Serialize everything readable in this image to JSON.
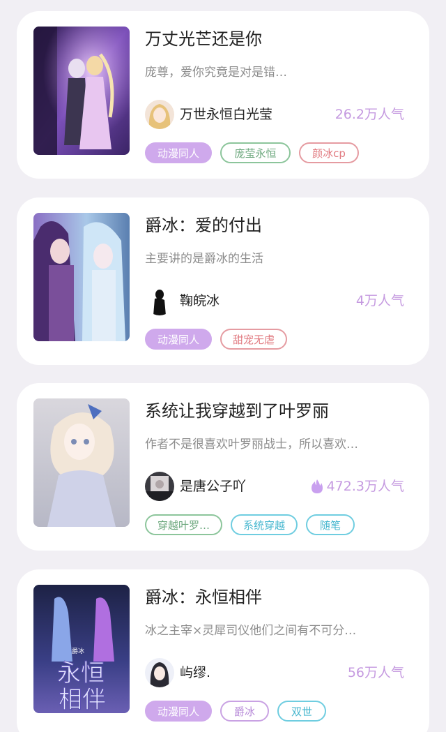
{
  "stories": [
    {
      "title": "万丈光芒还是你",
      "description": "庞尊，爱你究竟是对是错…",
      "author": "万世永恒白光莹",
      "popularity": "26.2万人气",
      "hot": false,
      "cover_icon": "cover-art-purple-couple",
      "tags": [
        {
          "label": "动漫同人",
          "style": "fill-purple"
        },
        {
          "label": "庞莹永恒",
          "style": "out-green"
        },
        {
          "label": "颜冰cp",
          "style": "out-red"
        }
      ]
    },
    {
      "title": "爵冰：爱的付出",
      "description": "主要讲的是爵冰的生活",
      "author": "鞠皖冰",
      "popularity": "4万人气",
      "hot": false,
      "cover_icon": "cover-art-blue-pair",
      "tags": [
        {
          "label": "动漫同人",
          "style": "fill-purple"
        },
        {
          "label": "甜宠无虐",
          "style": "out-red"
        }
      ]
    },
    {
      "title": "系统让我穿越到了叶罗丽",
      "description": "作者不是很喜欢叶罗丽战士，所以喜欢…",
      "author": "是唐公子吖",
      "popularity": "472.3万人气",
      "hot": true,
      "cover_icon": "cover-art-doll-girl",
      "tags": [
        {
          "label": "穿越叶罗…",
          "style": "out-green"
        },
        {
          "label": "系统穿越",
          "style": "out-cyan"
        },
        {
          "label": "随笔",
          "style": "out-cyan"
        }
      ]
    },
    {
      "title": "爵冰：永恒相伴",
      "description": "冰之主宰×灵犀司仪他们之间有不可分…",
      "author": "屿缪.",
      "popularity": "56万人气",
      "hot": false,
      "cover_icon": "cover-art-eternal-companion",
      "cover_text": {
        "small": "爵冰",
        "large": "永恒相伴"
      },
      "tags": [
        {
          "label": "动漫同人",
          "style": "fill-purple"
        },
        {
          "label": "爵冰",
          "style": "out-purple"
        },
        {
          "label": "双世",
          "style": "out-cyan"
        }
      ]
    }
  ],
  "colors": {
    "page_bg": "#f1eff4",
    "card_bg": "#ffffff",
    "popularity": "#c59ae0",
    "tag_purple_fill": "#cfa9ec"
  }
}
